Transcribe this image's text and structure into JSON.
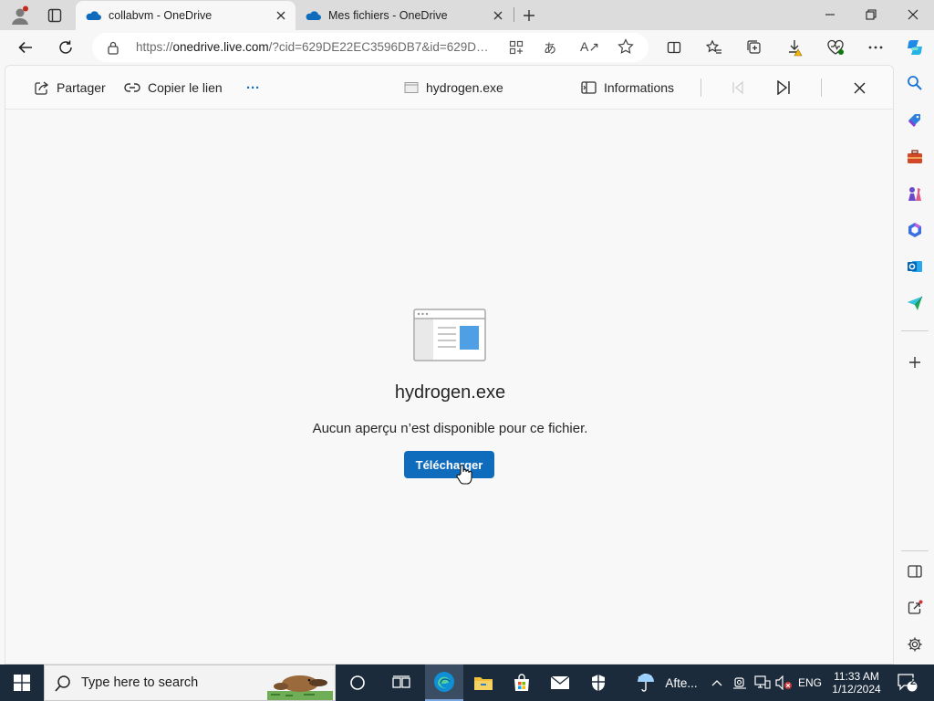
{
  "browser": {
    "tabs": [
      {
        "label": "collabvm - OneDrive",
        "active": true
      },
      {
        "label": "Mes fichiers - OneDrive",
        "active": false
      }
    ],
    "url": {
      "prefix": "https://",
      "host": "onedrive.live.com",
      "rest": "/?cid=629DE22EC3596DB7&id=629D…"
    }
  },
  "viewer": {
    "share_label": "Partager",
    "copy_link_label": "Copier le lien",
    "more_label": "···",
    "file_name": "hydrogen.exe",
    "info_label": "Informations"
  },
  "preview": {
    "title": "hydrogen.exe",
    "message": "Aucun aperçu n’est disponible pour ce fichier.",
    "download_label": "Télécharger"
  },
  "taskbar": {
    "search_placeholder": "Type here to search",
    "weather_label": "Afte...",
    "language": "ENG",
    "time": "11:33 AM",
    "date": "1/12/2024",
    "notification_count": "2"
  },
  "colors": {
    "accent": "#0f6cbd",
    "taskbar": "#1c2b3b",
    "tab_active": "#f7f7f7",
    "tab_strip": "#dcdcdc"
  }
}
